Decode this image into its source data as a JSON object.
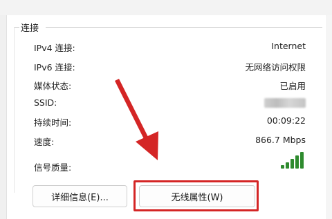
{
  "group": {
    "title": "连接"
  },
  "rows": [
    {
      "label": "IPv4 连接:",
      "value": "Internet"
    },
    {
      "label": "IPv6 连接:",
      "value": "无网络访问权限"
    },
    {
      "label": "媒体状态:",
      "value": "已启用"
    },
    {
      "label": "SSID:",
      "value": ""
    },
    {
      "label": "持续时间:",
      "value": "00:09:22"
    },
    {
      "label": "速度:",
      "value": "866.7 Mbps"
    },
    {
      "label": "信号质量:",
      "value": ""
    }
  ],
  "signal": {
    "icon": "signal-bars-icon",
    "level": 5,
    "max": 5,
    "color": "#2e8b2e"
  },
  "buttons": {
    "details": "详细信息(E)...",
    "wireless_properties": "无线属性(W)"
  },
  "annotation": {
    "highlight_color": "#d42525",
    "arrow_color": "#d42525"
  }
}
